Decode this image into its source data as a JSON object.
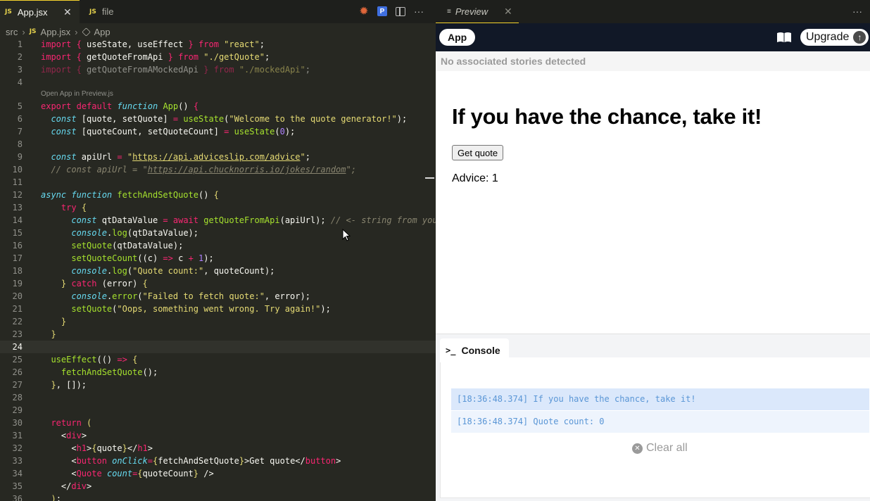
{
  "editor": {
    "tabs": [
      {
        "icon": "JS",
        "label": "App.jsx",
        "close": "✕"
      },
      {
        "icon": "JS",
        "label": "file"
      }
    ],
    "breadcrumb": {
      "folder": "src",
      "file_icon": "JS",
      "file": "App.jsx",
      "symbol": "App"
    },
    "codelens": "Open App in Preview.js",
    "line_numbers": [
      "1",
      "2",
      "3",
      "4",
      "5",
      "6",
      "7",
      "8",
      "9",
      "10",
      "11",
      "12",
      "13",
      "14",
      "15",
      "16",
      "17",
      "18",
      "19",
      "20",
      "21",
      "22",
      "23",
      "24",
      "25",
      "26",
      "27",
      "28",
      "29",
      "30",
      "31",
      "32",
      "33",
      "34",
      "35",
      "36"
    ],
    "code_plain": {
      "l1": "import { useState, useEffect } from \"react\";",
      "l2": "import { getQuoteFromApi } from \"./getQuote\";",
      "l3": "import { getQuoteFromAMockedApi } from \"./mockedApi\";",
      "l5": "export default function App() {",
      "l6": "  const [quote, setQuote] = useState(\"Welcome to the quote generator!\");",
      "l7": "  const [quoteCount, setQuoteCount] = useState(0);",
      "l9": "  const apiUrl = \"https://api.adviceslip.com/advice\";",
      "l10": "  // const apiUrl = \"https://api.chucknorris.io/jokes/random\";",
      "l12": "async function fetchAndSetQuote() {",
      "l13": "    try {",
      "l14": "      const qtDataValue = await getQuoteFromApi(apiUrl); // <- string from you",
      "l15": "      console.log(qtDataValue);",
      "l16": "      setQuote(qtDataValue);",
      "l17": "      setQuoteCount((c) => c + 1);",
      "l18": "      console.log(\"Quote count:\", quoteCount);",
      "l19": "    } catch (error) {",
      "l20": "      console.error(\"Failed to fetch quote:\", error);",
      "l21": "      setQuote(\"Oops, something went wrong. Try again!\");",
      "l22": "    }",
      "l23": "  }",
      "l25": "  useEffect(() => {",
      "l26": "    fetchAndSetQuote();",
      "l27": "  }, []);",
      "l30": "  return (",
      "l31": "    <div>",
      "l32": "      <h1>{quote}</h1>",
      "l33": "      <button onClick={fetchAndSetQuote}>Get quote</button>",
      "l34": "      <Quote count={quoteCount} />",
      "l35": "    </div>",
      "l36": "  );"
    }
  },
  "preview": {
    "tab_label": "Preview",
    "tab_close": "✕",
    "more": "···",
    "app_label": "App",
    "upgrade_label": "Upgrade",
    "no_stories": "No associated stories detected",
    "heading": "If you have the chance, take it!",
    "button_label": "Get quote",
    "advice_text": "Advice: 1"
  },
  "console": {
    "tab_label": "Console",
    "logs": [
      "[18:36:48.374] If you have the chance, take it!",
      "[18:36:48.374] Quote count: 0"
    ],
    "clear_label": "Clear all"
  },
  "colors": {
    "editor_bg": "#272822",
    "accent_tab": "#f6d32d",
    "preview_header": "#111827",
    "log_text": "#5a96d6"
  }
}
